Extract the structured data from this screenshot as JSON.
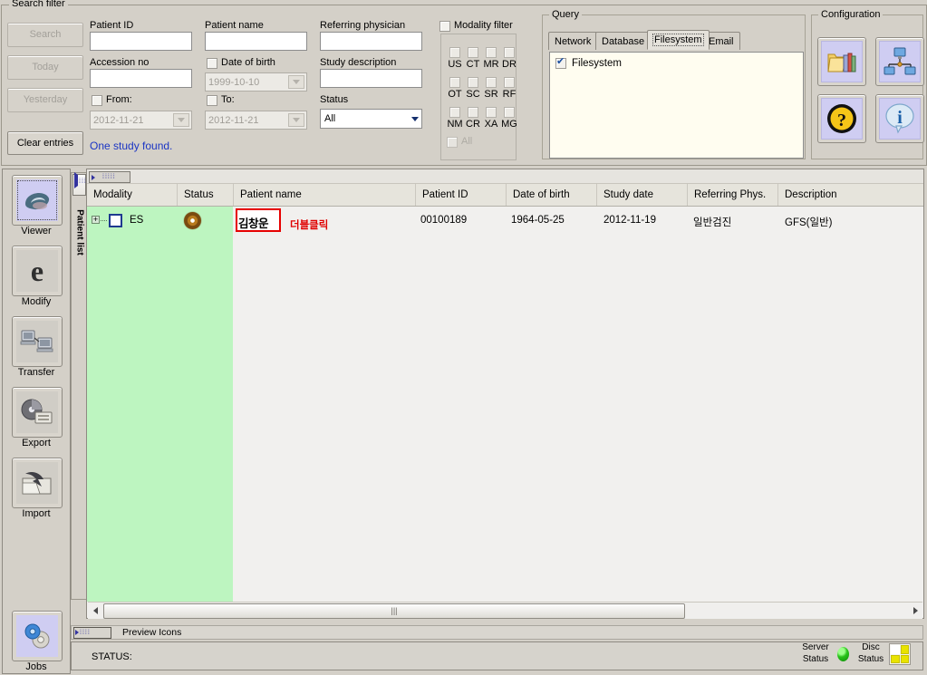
{
  "search_filter": {
    "title": "Search filter",
    "buttons": [
      {
        "label": "Search",
        "enabled": false
      },
      {
        "label": "Today",
        "enabled": false
      },
      {
        "label": "Yesterday",
        "enabled": false
      },
      {
        "label": "Clear entries",
        "enabled": true
      }
    ],
    "result_text": "One study found.",
    "fields": {
      "patient_id_label": "Patient ID",
      "patient_id_value": "",
      "accession_label": "Accession no",
      "accession_value": "",
      "from_label": "From:",
      "from_value": "2012-11-21",
      "patient_name_label": "Patient name",
      "patient_name_value": "",
      "dob_label": "Date of birth",
      "dob_value": "1999-10-10",
      "to_label": "To:",
      "to_value": "2012-11-21",
      "referring_label": "Referring physician",
      "referring_value": "",
      "study_desc_label": "Study description",
      "study_desc_value": "",
      "status_label": "Status",
      "status_value": "All"
    }
  },
  "modality_filter": {
    "label": "Modality filter",
    "checked": false,
    "items": [
      "US",
      "CT",
      "MR",
      "DR",
      "OT",
      "SC",
      "SR",
      "RF",
      "NM",
      "CR",
      "XA",
      "MG"
    ],
    "all_label": "All"
  },
  "query": {
    "title": "Query",
    "tabs": [
      {
        "label": "Network",
        "active": false
      },
      {
        "label": "Database",
        "active": false
      },
      {
        "label": "Filesystem",
        "active": true
      },
      {
        "label": "Email",
        "active": false
      }
    ],
    "list_items": [
      {
        "label": "Filesystem",
        "checked": true
      }
    ]
  },
  "configuration": {
    "title": "Configuration",
    "buttons": [
      {
        "icon": "database-config-icon",
        "name": "database-config-button"
      },
      {
        "icon": "network-config-icon",
        "name": "network-config-button"
      },
      {
        "icon": "help-question-icon",
        "name": "help-button"
      },
      {
        "icon": "info-icon",
        "name": "about-button"
      }
    ]
  },
  "sidebar": {
    "items": [
      {
        "label": "Viewer",
        "icon": "viewer-icon",
        "selected": true
      },
      {
        "label": "Modify",
        "icon": "modify-e-icon",
        "selected": false
      },
      {
        "label": "Transfer",
        "icon": "transfer-icon",
        "selected": false
      },
      {
        "label": "Export",
        "icon": "export-disc-icon",
        "selected": false
      },
      {
        "label": "Import",
        "icon": "import-folder-icon",
        "selected": false
      }
    ],
    "jobs": {
      "label": "Jobs",
      "icon": "jobs-gears-icon"
    }
  },
  "patient_list_tab": {
    "label": "Patient list"
  },
  "table": {
    "columns": [
      "Modality",
      "Status",
      "Patient name",
      "Patient ID",
      "Date of birth",
      "Study date",
      "Referring Phys.",
      "Description"
    ],
    "rows": [
      {
        "modality": "ES",
        "status_icon": "cd-disc-icon",
        "checked": false,
        "expanded": false,
        "patient_name": "김창운",
        "patient_id": "00100189",
        "date_of_birth": "1964-05-25",
        "study_date": "2012-11-19",
        "referring_phys": "일반검진",
        "description": "GFS(일반)"
      }
    ],
    "annotation": "더블클릭"
  },
  "preview_bar": {
    "label": "Preview Icons"
  },
  "status_bar": {
    "status_label": "STATUS:",
    "server_status_line1": "Server",
    "server_status_line2": "Status",
    "disc_status_line1": "Disc",
    "disc_status_line2": "Status"
  },
  "colors": {
    "window_bg": "#d4d0c8",
    "selected_row": "#bdf5c0",
    "info_text": "#1b35c4",
    "annotation_red": "#e00000",
    "query_list_bg": "#fffdf0",
    "icon_lavender": "#cfcdf2",
    "server_led_green": "#27c219",
    "disc_yellow": "#e9e300"
  }
}
